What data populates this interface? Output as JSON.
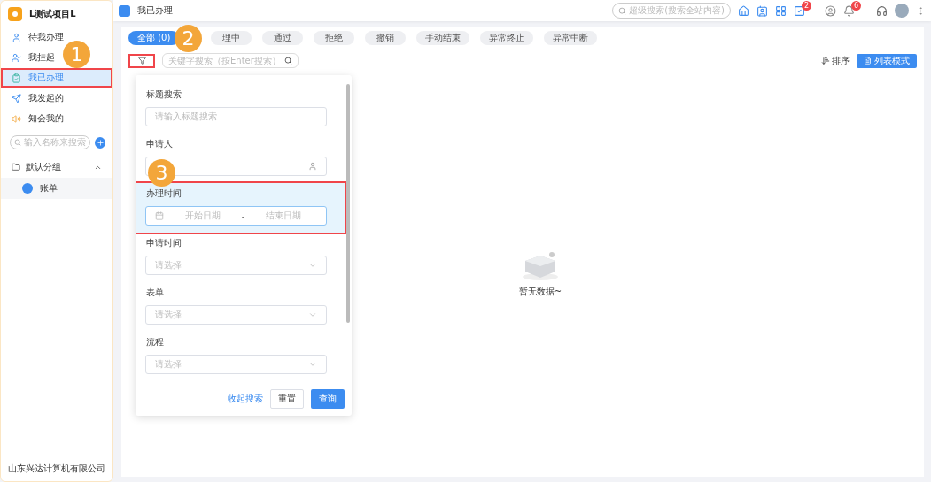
{
  "app": {
    "title": "L测试项目L",
    "footer": "山东兴达计算机有限公司"
  },
  "sidebar": {
    "items": [
      {
        "label": "待我办理",
        "kind": "user",
        "selected": false,
        "annotated": false
      },
      {
        "label": "我挂起",
        "kind": "pause",
        "selected": false,
        "annotated": false
      },
      {
        "label": "我已办理",
        "kind": "done",
        "selected": true,
        "annotated": true
      },
      {
        "label": "我发起的",
        "kind": "send",
        "selected": false,
        "annotated": false
      },
      {
        "label": "知会我的",
        "kind": "notify",
        "selected": false,
        "annotated": false
      }
    ],
    "search": {
      "placeholder": "输入名称来搜索"
    },
    "groups": [
      {
        "label": "默认分组",
        "expanded": true,
        "children": [
          {
            "label": "账单"
          }
        ]
      }
    ]
  },
  "header": {
    "page_title": "我已办理",
    "search": {
      "placeholder": "超级搜索(搜索全站内容)"
    },
    "badges": [
      "2",
      "6"
    ]
  },
  "tabs": [
    {
      "label": "全部 (0)",
      "selected": true
    },
    {
      "label": "理中",
      "selected": false
    },
    {
      "label": "通过",
      "selected": false
    },
    {
      "label": "拒绝",
      "selected": false
    },
    {
      "label": "撤销",
      "selected": false
    },
    {
      "label": "手动结束",
      "selected": false
    },
    {
      "label": "异常终止",
      "selected": false
    },
    {
      "label": "异常中断",
      "selected": false
    }
  ],
  "toolbar": {
    "filter_annotated": true,
    "search": {
      "placeholder": "关键字搜索（按Enter搜索）"
    },
    "sort": "排序",
    "view_mode": "列表模式"
  },
  "filter_panel": {
    "fields": [
      {
        "label": "标题搜索",
        "kind": "text",
        "placeholder": "请输入标题搜索",
        "annotated": false
      },
      {
        "label": "申请人",
        "kind": "person",
        "annotated": false
      },
      {
        "label": "办理时间",
        "kind": "daterange",
        "start": "开始日期",
        "separator": "-",
        "end": "结束日期",
        "annotated": true
      },
      {
        "label": "申请时间",
        "kind": "select",
        "placeholder": "请选择",
        "annotated": false
      },
      {
        "label": "表单",
        "kind": "select",
        "placeholder": "请选择",
        "annotated": false
      },
      {
        "label": "流程",
        "kind": "select",
        "placeholder": "请选择",
        "annotated": false
      }
    ],
    "actions": {
      "collapse": "收起搜索",
      "reset": "重置",
      "query": "查询"
    }
  },
  "empty_state": {
    "text": "暂无数据~"
  },
  "callouts": [
    "1",
    "2",
    "3"
  ]
}
